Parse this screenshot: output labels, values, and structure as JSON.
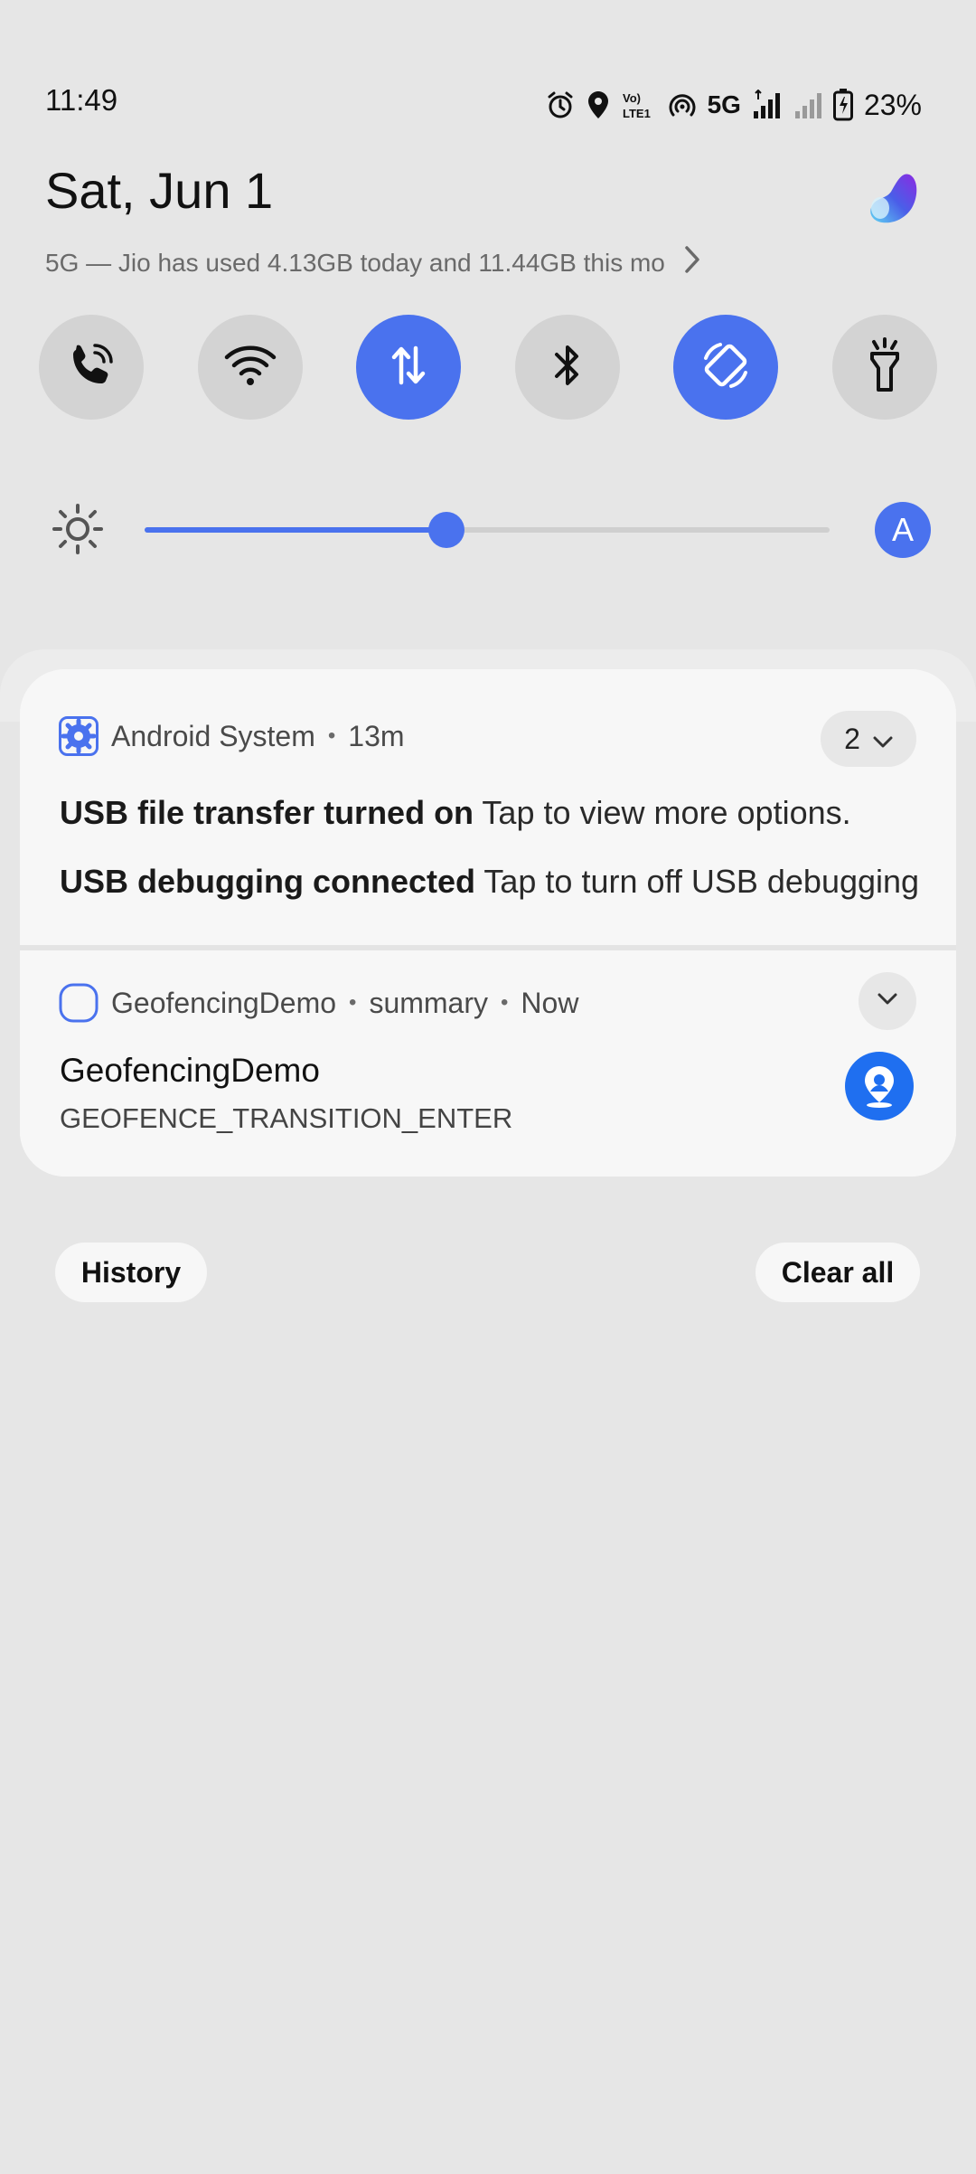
{
  "status_bar": {
    "time": "11:49",
    "network_label": "5G",
    "volte_label": "Vo) LTE1",
    "battery_percent": "23%",
    "icons": [
      "alarm-icon",
      "location-icon",
      "volte-icon",
      "hotspot-icon",
      "signal-strong-icon",
      "signal-weak-icon",
      "battery-charging-icon"
    ]
  },
  "header": {
    "date": "Sat, Jun 1",
    "data_usage": "5G — Jio has used 4.13GB today and 11.44GB this mo"
  },
  "quick_settings": {
    "tiles": [
      {
        "name": "wifi-calling",
        "icon": "phone-wifi-icon",
        "active": false
      },
      {
        "name": "wifi",
        "icon": "wifi-icon",
        "active": false
      },
      {
        "name": "mobile-data",
        "icon": "data-arrows-icon",
        "active": true
      },
      {
        "name": "bluetooth",
        "icon": "bluetooth-icon",
        "active": false
      },
      {
        "name": "auto-rotate",
        "icon": "rotate-icon",
        "active": true
      },
      {
        "name": "flashlight",
        "icon": "flashlight-icon",
        "active": false
      }
    ]
  },
  "brightness": {
    "level": 0.44,
    "auto_label": "A"
  },
  "notifications": {
    "group": {
      "app_name": "Android System",
      "time": "13m",
      "count": "2",
      "items": [
        {
          "title": "USB file transfer turned on",
          "text": "Tap to view more options."
        },
        {
          "title": "USB debugging connected",
          "text": "Tap to turn off USB debugging"
        }
      ]
    },
    "single": {
      "app_name": "GeofencingDemo",
      "subtext": "summary",
      "time": "Now",
      "title": "GeofencingDemo",
      "text": "GEOFENCE_TRANSITION_ENTER"
    }
  },
  "actions": {
    "history_label": "History",
    "clear_all_label": "Clear all"
  },
  "colors": {
    "accent": "#4a72ee",
    "background": "#e6e6e6",
    "card": "#f7f7f7",
    "tile_inactive": "#d3d3d3"
  }
}
